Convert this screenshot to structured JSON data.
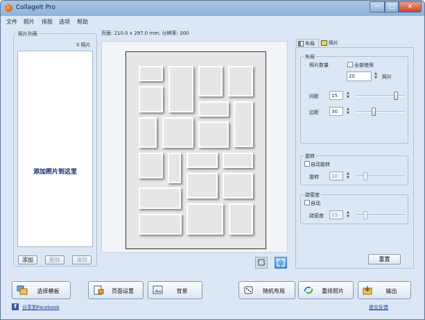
{
  "window": {
    "title": "CollageIt Pro",
    "controls": {
      "minimize": "─",
      "maximize": "□",
      "close": "✕"
    }
  },
  "menu": [
    "文件",
    "照片",
    "排版",
    "选项",
    "帮助"
  ],
  "page_info": "页面: 210.0 x 297.0 mm, 分辨率: 300",
  "photo_list": {
    "title": "照片列表",
    "count": "0 照片",
    "drop_hint": "添加照片到这里",
    "add_label": "添加",
    "remove_label": "删除",
    "clear_label": "清除"
  },
  "tabs": {
    "layout": "布局",
    "photo": "照片"
  },
  "layout": {
    "title": "布局",
    "photo_count_label": "照片数量",
    "use_all_label": "全部使用",
    "photo_count_value": "20",
    "photo_unit": "照片",
    "spacing_label": "间距",
    "spacing_value": "15",
    "spacing_level": 0.85,
    "margin_label": "边距",
    "margin_value": "30",
    "margin_level": 0.35
  },
  "rotation": {
    "title": "旋转",
    "auto_label": "自动旋转",
    "angle_label": "旋转",
    "angle_value": "10",
    "angle_level": 0.15
  },
  "sparsity": {
    "title": "疏密度",
    "auto_label": "自动",
    "density_label": "疏密度",
    "density_value": "23",
    "density_level": 0.15
  },
  "reset_label": "重置",
  "toolbar": {
    "select_template": "选择模板",
    "page_setup": "页面设置",
    "background": "背景",
    "random_layout": "随机布局",
    "reshuffle": "重排照片",
    "output": "输出"
  },
  "footer": {
    "share": "分享到Facebook",
    "feedback": "提交反馈"
  },
  "colors": {
    "accent": "#0d3c98",
    "close_button": "#c8432a",
    "panel": "#dbe7f4"
  }
}
